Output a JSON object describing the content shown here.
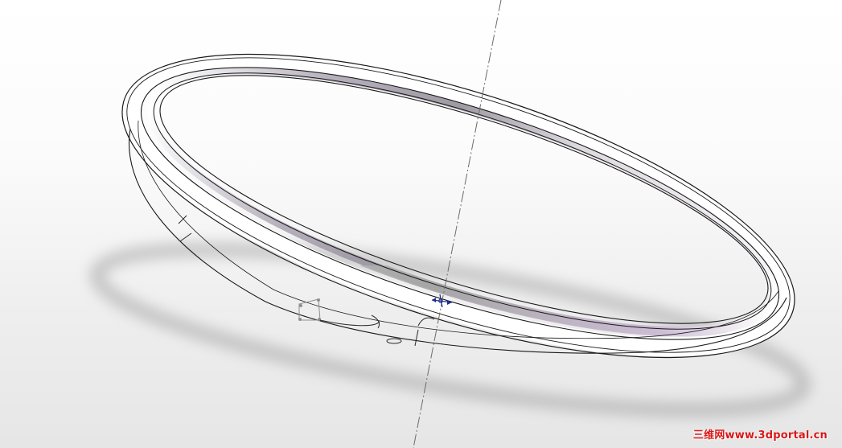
{
  "viewport": {
    "background_top": "#ffffff",
    "background_bottom": "#e6e6e6"
  },
  "model": {
    "part": "elliptical-ring",
    "edge_color": "#1a1a1a",
    "face_highlight": "#bdb3c6",
    "shadow_color": "#7a7a7a"
  },
  "axis": {
    "style": "dash-dot",
    "color": "#6b6b6b"
  },
  "origin_marker": {
    "color": "#1b2e8a"
  },
  "watermark": {
    "text": "三维网www.3dportal.cn",
    "color": "#d81818"
  }
}
